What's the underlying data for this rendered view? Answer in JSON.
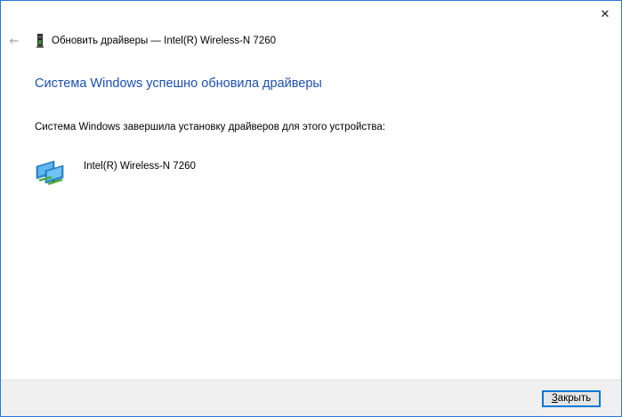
{
  "window": {
    "close_glyph": "✕"
  },
  "header": {
    "back_glyph": "←",
    "title": "Обновить драйверы — Intel(R) Wireless-N 7260"
  },
  "main": {
    "heading": "Система Windows успешно обновила драйверы",
    "info": "Система Windows завершила установку драйверов для этого устройства:",
    "device_name": "Intel(R) Wireless-N 7260",
    "device_icon": "network-adapter-icon"
  },
  "footer": {
    "close_button_mnemonic": "З",
    "close_button_rest": "акрыть"
  },
  "colors": {
    "heading": "#1b4fb3",
    "window_border": "#2b79d6",
    "footer_bg": "#f0f0f0",
    "button_focus": "#0078d7"
  }
}
